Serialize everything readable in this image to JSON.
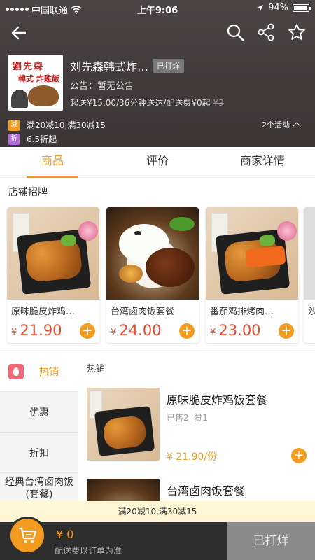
{
  "status_bar": {
    "carrier": "中国联通",
    "time": "上午9:06",
    "battery": "94%"
  },
  "shop": {
    "name": "刘先森韩式炸…",
    "closed_badge": "已打烊",
    "notice": "公告：暂无公告",
    "delivery_info": "起送¥15.00/36分钟送达/配送费¥0起",
    "delivery_original_fee": "¥3",
    "logo_text_line1": "劉先森",
    "logo_text_line2": "韓式 炸雞飯"
  },
  "promotions": [
    {
      "tag": "減",
      "tag_color": "#f29b1f",
      "text": "满20减10,满30减15"
    },
    {
      "tag": "折",
      "tag_color": "#b06ad9",
      "text": "6.5折起"
    }
  ],
  "activity_count": "2个活动",
  "tabs": [
    {
      "label": "商品",
      "active": true
    },
    {
      "label": "评价",
      "active": false
    },
    {
      "label": "商家详情",
      "active": false
    }
  ],
  "featured": {
    "title": "店铺招牌",
    "items": [
      {
        "name": "原味脆皮炸鸡…",
        "currency": "¥",
        "price": "21.90"
      },
      {
        "name": "台湾卤肉饭套餐",
        "currency": "¥",
        "price": "24.00"
      },
      {
        "name": "番茄鸡排烤肉…",
        "currency": "¥",
        "price": "23.00"
      },
      {
        "name": "沙"
      }
    ]
  },
  "categories": [
    {
      "label": "热销",
      "active": true,
      "icon": "fire-icon"
    },
    {
      "label": "优惠",
      "active": false
    },
    {
      "label": "折扣",
      "active": false
    },
    {
      "label": "经典台湾卤肉饭(套餐)",
      "active": false
    }
  ],
  "section_title": "热销",
  "products": [
    {
      "name": "原味脆皮炸鸡饭套餐",
      "sold": "已售2",
      "likes": "赞1",
      "price": "¥ 21.90/份"
    },
    {
      "name": "台湾卤肉饭套餐"
    }
  ],
  "discount_bar": "满20减10,满30减15",
  "cart": {
    "amount": "¥ 0",
    "fee_note": "配送费以订单为准",
    "closed_label": "已打烊"
  },
  "colors": {
    "accent": "#f29b1f",
    "price_red": "#e5492d",
    "header_bg": "#3e3839"
  }
}
